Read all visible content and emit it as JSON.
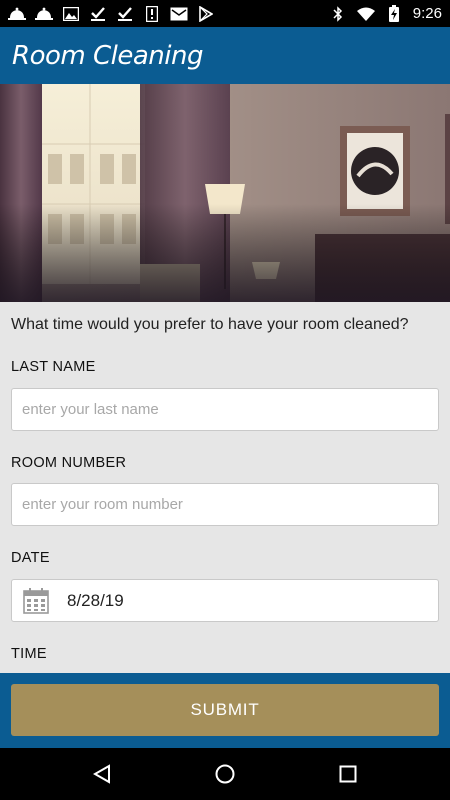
{
  "status_bar": {
    "time": "9:26",
    "left_icons": [
      "bell-icon",
      "bell-icon",
      "image-icon",
      "check-icon",
      "check-icon",
      "alert-icon",
      "mail-icon",
      "play-store-icon"
    ],
    "right_icons": [
      "bluetooth-icon",
      "wifi-icon",
      "battery-charging-icon"
    ]
  },
  "app_bar": {
    "title": "Room Cleaning",
    "background_color": "#0b5c92"
  },
  "form": {
    "prompt": "What time would you prefer to have your room cleaned?",
    "last_name": {
      "label": "LAST NAME",
      "placeholder": "enter your last name",
      "value": ""
    },
    "room_number": {
      "label": "ROOM NUMBER",
      "placeholder": "enter your room number",
      "value": ""
    },
    "date": {
      "label": "DATE",
      "value": "8/28/19",
      "icon": "calendar-icon"
    },
    "time": {
      "label": "TIME"
    },
    "submit_label": "SUBMIT",
    "submit_color": "#a58f5a"
  },
  "nav_bar": {
    "buttons": [
      "back-icon",
      "home-icon",
      "recents-icon"
    ]
  }
}
